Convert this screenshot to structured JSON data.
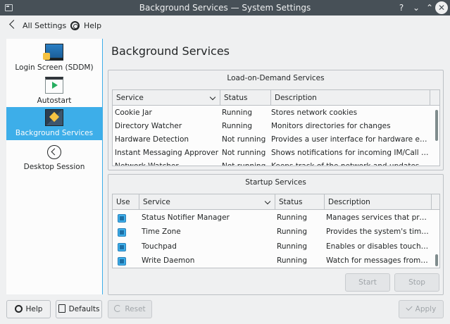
{
  "window": {
    "title": "Background Services — System Settings"
  },
  "titlebar_buttons": {
    "help": "?",
    "minimize": "⌄",
    "maximize": "⌃",
    "close": "✕"
  },
  "toolbar": {
    "back_label": "All Settings",
    "help_label": "Help"
  },
  "sidebar": {
    "items": [
      {
        "label": "Login Screen (SDDM)",
        "icon": "login-screen-icon",
        "active": false
      },
      {
        "label": "Autostart",
        "icon": "autostart-icon",
        "active": false
      },
      {
        "label": "Background Services",
        "icon": "background-services-icon",
        "active": true
      },
      {
        "label": "Desktop Session",
        "icon": "desktop-session-icon",
        "active": false
      }
    ]
  },
  "main": {
    "title": "Background Services",
    "load_on_demand": {
      "title": "Load-on-Demand Services",
      "columns": [
        "Service",
        "Status",
        "Description"
      ],
      "rows": [
        {
          "service": "Cookie Jar",
          "status": "Running",
          "description": "Stores network cookies"
        },
        {
          "service": "Directory Watcher",
          "status": "Running",
          "description": "Monitors directories for changes"
        },
        {
          "service": "Hardware Detection",
          "status": "Not running",
          "description": "Provides a user interface for hardware events"
        },
        {
          "service": "Instant Messaging Approver",
          "status": "Not running",
          "description": "Shows notifications for incoming IM/Call req..."
        },
        {
          "service": "Network Watcher",
          "status": "Not running",
          "description": "Keeps track of the network and updates dire..."
        }
      ]
    },
    "startup": {
      "title": "Startup Services",
      "columns": [
        "Use",
        "Service",
        "Status",
        "Description"
      ],
      "rows": [
        {
          "use": true,
          "service": "Status Notifier Manager",
          "status": "Running",
          "description": "Manages services that provi..."
        },
        {
          "use": true,
          "service": "Time Zone",
          "status": "Running",
          "description": "Provides the system's time z..."
        },
        {
          "use": true,
          "service": "Touchpad",
          "status": "Running",
          "description": "Enables or disables touchpad"
        },
        {
          "use": true,
          "service": "Write Daemon",
          "status": "Running",
          "description": "Watch for messages from lo..."
        }
      ],
      "start_label": "Start",
      "stop_label": "Stop"
    }
  },
  "footer": {
    "help_label": "Help",
    "defaults_label": "Defaults",
    "reset_label": "Reset",
    "apply_label": "Apply"
  },
  "colors": {
    "accent": "#3daee9",
    "titlebar": "#475057",
    "background": "#eff0f1"
  }
}
